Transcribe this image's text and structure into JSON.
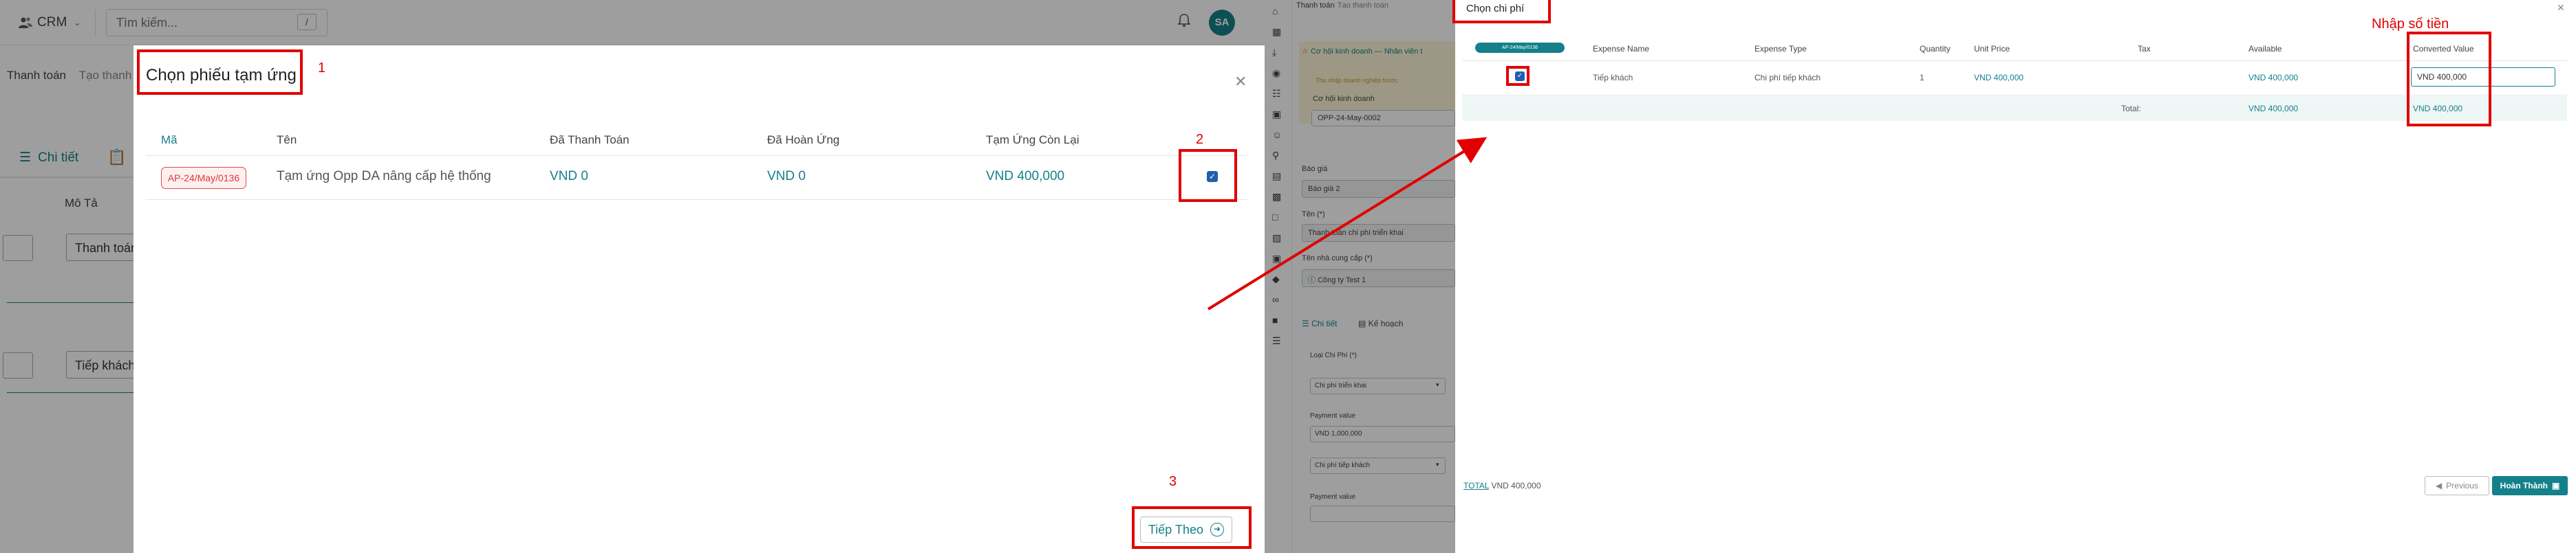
{
  "left": {
    "topbar": {
      "app_name": "CRM",
      "search_placeholder": "Tìm kiếm...",
      "shortcut_key": "/",
      "avatar_initials": "SA"
    },
    "background": {
      "breadcrumb_root": "Thanh toán",
      "breadcrumb_current": "Tạo thanh",
      "tab_label": "Chi tiết",
      "column_header": "Mô Tả",
      "row1_value": "Thanh toán",
      "row2_value": "Tiếp khách"
    },
    "modal": {
      "title": "Chọn phiếu tạm ứng",
      "columns": [
        "Mã",
        "Tên",
        "Đã Thanh Toán",
        "Đã Hoàn Ứng",
        "Tạm Ứng Còn Lại"
      ],
      "row": {
        "code": "AP-24/May/0136",
        "name": "Tạm ứng Opp DA nâng cấp hệ thống",
        "paid": "VND 0",
        "refunded": "VND 0",
        "remaining": "VND 400,000",
        "selected": true
      },
      "next_button": "Tiếp Theo"
    },
    "annotations": {
      "step1": "1",
      "step2": "2",
      "step3": "3"
    }
  },
  "right": {
    "background": {
      "breadcrumb_root": "Thanh toán",
      "breadcrumb_current": "Tạo thanh toán",
      "opportunity_link": "Cơ hội kinh doanh",
      "employee_link": "Nhân viên t",
      "warning_text": "Thu nhập doanh nghiệp trước",
      "opportunity_label": "Cơ hội kinh doanh",
      "opportunity_value": "OPP-24-May-0002",
      "quote_label": "Báo giá",
      "quote_value": "Báo giá 2",
      "name_label": "Tên (*)",
      "name_value": "Thanh toán chi phí triển khai",
      "supplier_label": "Tên nhà cung cấp (*)",
      "supplier_value": "Công ty Test 1",
      "tab_detail": "Chi tiết",
      "tab_plan": "Kế hoạch",
      "expense_type_label": "Loại Chi Phí (*)",
      "expense_type_1": "Chi phí triển khai",
      "payment_value_label_1": "Payment value",
      "payment_value_1": "VND 1,000,000",
      "expense_type_2": "Chi phí tiếp khách",
      "payment_value_label_2": "Payment value"
    },
    "modal": {
      "title": "Chọn chi phí",
      "badge_code": "AP-24/May/0136",
      "columns": [
        "Expense Name",
        "Expense Type",
        "Quantity",
        "Unit Price",
        "Tax",
        "Available",
        "Converted Value"
      ],
      "row": {
        "selected": true,
        "expense_name": "Tiếp khách",
        "expense_type": "Chi phí tiếp khách",
        "quantity": "1",
        "unit_price": "VND 400,000",
        "available": "VND 400,000",
        "converted_value": "VND 400,000"
      },
      "total_label": "Total:",
      "total_available": "VND 400,000",
      "total_converted": "VND 400,000",
      "footer_total_label": "TOTAL",
      "footer_total_value": "VND 400,000",
      "previous_button": "Previous",
      "finish_button": "Hoàn Thành"
    },
    "annotations": {
      "enter_amount": "Nhập số tiền"
    }
  },
  "colors": {
    "accent": "#14808a",
    "annotation_red": "#e00000",
    "checkbox_blue": "#1f5fb0",
    "badge_red": "#d9383a"
  }
}
